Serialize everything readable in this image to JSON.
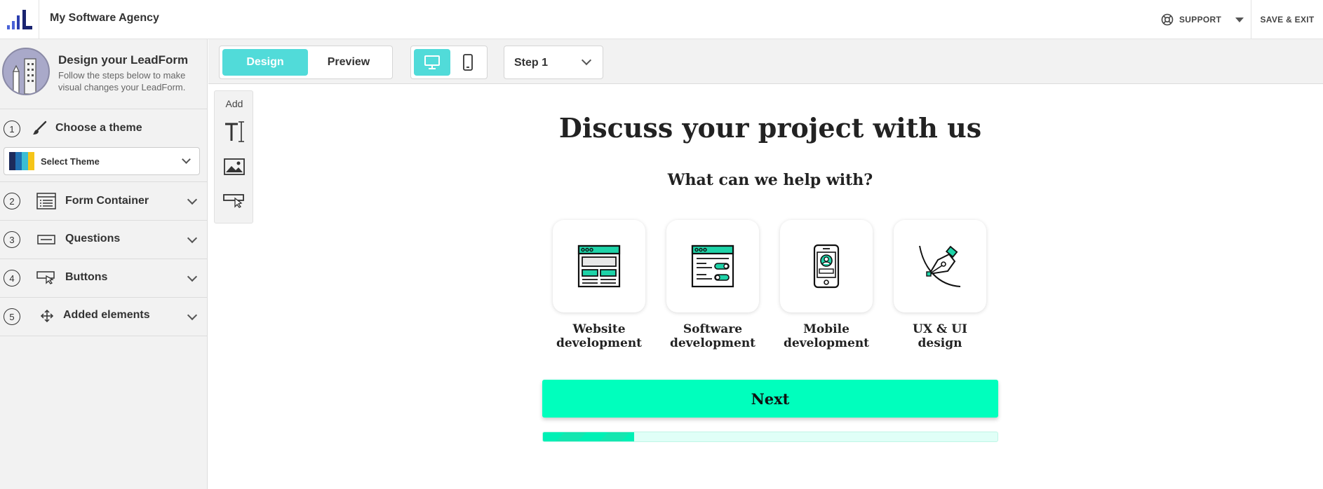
{
  "topbar": {
    "app_name": "My Software Agency",
    "support_label": "SUPPORT",
    "save_exit_label": "SAVE & EXIT"
  },
  "sidebar": {
    "title": "Design your LeadForm",
    "subtitle": "Follow the steps below to make visual changes your LeadForm.",
    "steps": [
      {
        "num": "1",
        "label": "Choose a theme",
        "icon": "brush-icon"
      },
      {
        "num": "2",
        "label": "Form Container",
        "icon": "form-container-icon"
      },
      {
        "num": "3",
        "label": "Questions",
        "icon": "question-field-icon"
      },
      {
        "num": "4",
        "label": "Buttons",
        "icon": "button-pointer-icon"
      },
      {
        "num": "5",
        "label": "Added elements",
        "icon": "move-arrows-icon"
      }
    ],
    "theme_select_label": "Select Theme",
    "theme_swatch_colors": [
      "#1d2b5c",
      "#1f6fb2",
      "#3bbdd4",
      "#f5c518"
    ]
  },
  "toolbar": {
    "design_label": "Design",
    "preview_label": "Preview",
    "step_select_label": "Step 1",
    "accent_color": "#51dbd9"
  },
  "add_panel": {
    "title": "Add",
    "tools": [
      "text-tool-icon",
      "image-tool-icon",
      "button-tool-icon"
    ]
  },
  "form": {
    "title": "Discuss your project with us",
    "question": "What can we help with?",
    "options": [
      {
        "label_line1": "Website",
        "label_line2": "development",
        "icon": "website-icon"
      },
      {
        "label_line1": "Software",
        "label_line2": "development",
        "icon": "software-icon"
      },
      {
        "label_line1": "Mobile",
        "label_line2": "development",
        "icon": "mobile-icon"
      },
      {
        "label_line1": "UX & UI",
        "label_line2": "design",
        "icon": "pen-tool-icon"
      }
    ],
    "next_label": "Next",
    "progress_fraction": 0.2,
    "button_color": "#00ffbd"
  }
}
